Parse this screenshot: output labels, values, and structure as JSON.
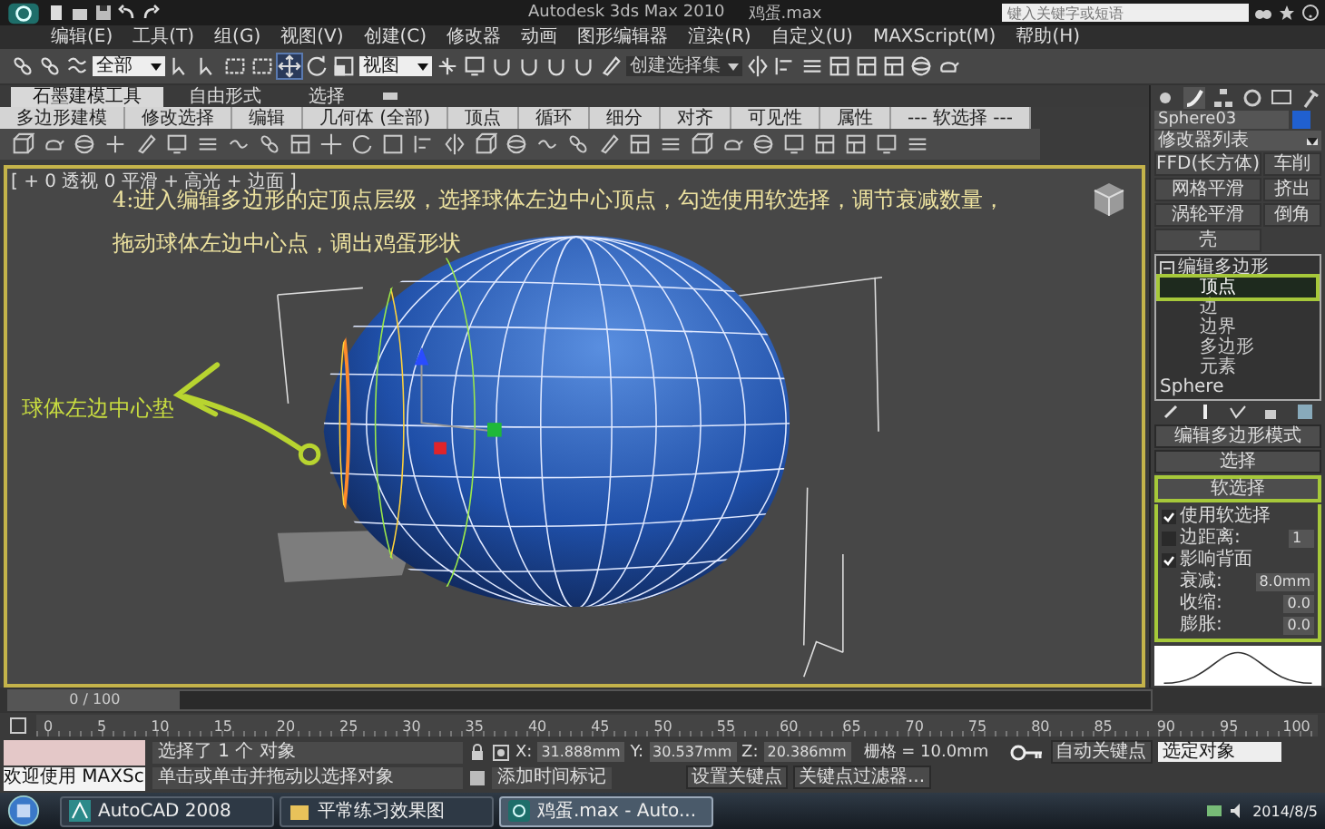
{
  "window": {
    "title": "Autodesk 3ds Max 2010",
    "file": "鸡蛋.max"
  },
  "search": {
    "placeholder": "键入关键字或短语"
  },
  "menu": [
    "编辑(E)",
    "工具(T)",
    "组(G)",
    "视图(V)",
    "创建(C)",
    "修改器",
    "动画",
    "图形编辑器",
    "渲染(R)",
    "自定义(U)",
    "MAXScript(M)",
    "帮助(H)"
  ],
  "toolbar": {
    "dropdowns": [
      "全部",
      "视图",
      "创建选择集"
    ]
  },
  "ribbon": {
    "tabs": [
      {
        "label": "石墨建模工具",
        "selected": true
      },
      {
        "label": "自由形式",
        "selected": false
      },
      {
        "label": "选择",
        "selected": false
      }
    ],
    "panels": [
      "多边形建模",
      "修改选择",
      "编辑",
      "几何体 (全部)",
      "顶点",
      "循环",
      "细分",
      "对齐",
      "可见性",
      "属性",
      "--- 软选择 ---"
    ]
  },
  "viewport": {
    "label": "[ + 0 透视 0 平滑 + 高光 + 边面 ]",
    "instructions": [
      "4:进入编辑多边形的定顶点层级，选择球体左边中心顶点，勾选使用软选择，调节衰减数量，",
      "拖动球体左边中心点，调出鸡蛋形状"
    ],
    "callout": "球体左边中心垫"
  },
  "command_panel": {
    "object_name": "Sphere03",
    "modifier_list": "修改器列表",
    "modifier_buttons": [
      "FFD(长方体)",
      "车削",
      "网格平滑",
      "挤出",
      "涡轮平滑",
      "倒角",
      "壳"
    ],
    "stack": [
      {
        "label": "编辑多边形",
        "expanded": true,
        "children": [
          {
            "label": "顶点",
            "selected": true
          },
          {
            "label": "边",
            "selected": false
          },
          {
            "label": "边界",
            "selected": false
          },
          {
            "label": "多边形",
            "selected": false
          },
          {
            "label": "元素",
            "selected": false
          }
        ]
      },
      {
        "label": "Sphere"
      }
    ],
    "rollouts": [
      {
        "label": "编辑多边形模式",
        "expanded": false
      },
      {
        "label": "选择",
        "expanded": false
      },
      {
        "label": "软选择",
        "expanded": true
      }
    ],
    "soft_selection": [
      {
        "kind": "checkbox",
        "label": "使用软选择",
        "checked": true
      },
      {
        "kind": "checkbox-spinner",
        "label": "边距离:",
        "checked": false,
        "value": "1"
      },
      {
        "kind": "checkbox",
        "label": "影响背面",
        "checked": true
      },
      {
        "kind": "spinner",
        "label": "衰减:",
        "value": "8.0mm"
      },
      {
        "kind": "spinner",
        "label": "收缩:",
        "value": "0.0"
      },
      {
        "kind": "spinner",
        "label": "膨胀:",
        "value": "0.0"
      }
    ]
  },
  "timeline": {
    "position": "0 / 100",
    "level": 0,
    "ticks": [
      "0",
      "5",
      "10",
      "15",
      "20",
      "25",
      "30",
      "35",
      "40",
      "45",
      "50",
      "55",
      "60",
      "65",
      "70",
      "75",
      "80",
      "85",
      "90",
      "95",
      "100"
    ]
  },
  "status": {
    "listener": "欢迎使用 MAXSc",
    "selection": "选择了 1 个 对象",
    "prompt": "单击或单击并拖动以选择对象",
    "coords": [
      {
        "axis": "X:",
        "value": "31.888mm"
      },
      {
        "axis": "Y:",
        "value": "30.537mm"
      },
      {
        "axis": "Z:",
        "value": "20.386mm"
      }
    ],
    "grid": "栅格 = 10.0mm",
    "add_time_tag": "添加时间标记",
    "auto_key": "自动关键点",
    "key_mode": "选定对象",
    "set_key": "设置关键点",
    "key_filters": "关键点过滤器..."
  },
  "taskbar": {
    "items": [
      {
        "label": "AutoCAD 2008",
        "kind": "cad",
        "selected": false
      },
      {
        "label": "平常练习效果图",
        "kind": "folder",
        "selected": false
      },
      {
        "label": "鸡蛋.max - Auto...",
        "kind": "max",
        "selected": true
      }
    ],
    "date": "2014/8/5"
  }
}
